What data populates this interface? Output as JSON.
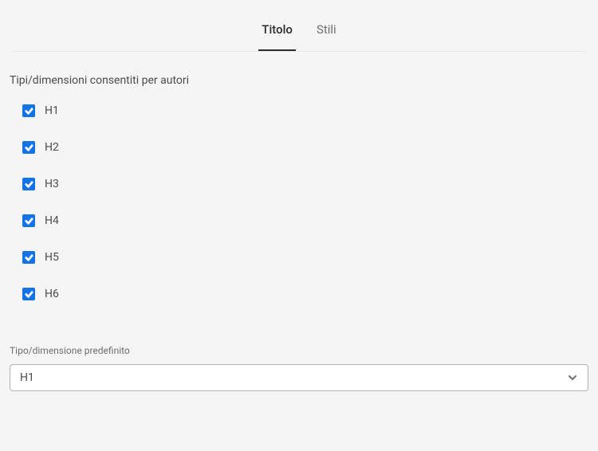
{
  "tabs": {
    "titolo": "Titolo",
    "stili": "Stili"
  },
  "allowed_types_label": "Tipi/dimensioni consentiti per autori",
  "options": [
    {
      "label": "H1",
      "checked": true
    },
    {
      "label": "H2",
      "checked": true
    },
    {
      "label": "H3",
      "checked": true
    },
    {
      "label": "H4",
      "checked": true
    },
    {
      "label": "H5",
      "checked": true
    },
    {
      "label": "H6",
      "checked": true
    }
  ],
  "default_type_label": "Tipo/dimensione predefinito",
  "default_type_value": "H1"
}
